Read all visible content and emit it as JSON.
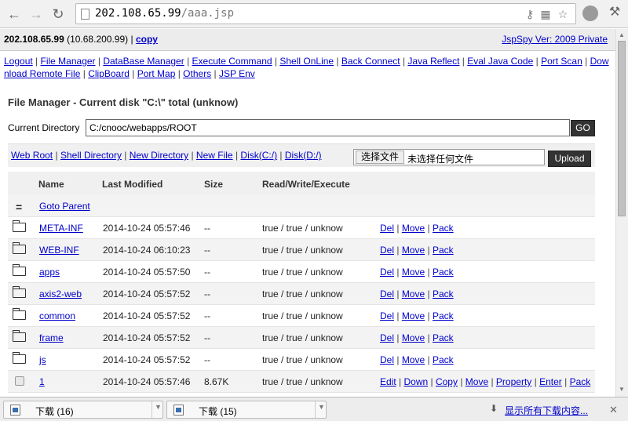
{
  "browser": {
    "url_host": "202.108.65.99",
    "url_path": "/aaa.jsp"
  },
  "header": {
    "ip_bold": "202.108.65.99",
    "ip_inner": " (10.68.200.99) | ",
    "copy_label": "copy",
    "version_label": "JspSpy Ver: 2009 Private"
  },
  "nav_links": [
    "Logout",
    "File Manager",
    "DataBase Manager",
    "Execute Command",
    "Shell OnLine",
    "Back Connect",
    "Java Reflect",
    "Eval Java Code",
    "Port Scan",
    "Download Remote File",
    "ClipBoard",
    "Port Map",
    "Others",
    "JSP Env"
  ],
  "page_title": "File Manager - Current disk \"C:\\\" total (unknow)",
  "current_dir": {
    "label": "Current Directory",
    "value": "C:/cnooc/webapps/ROOT",
    "go_label": "GO"
  },
  "quick_links": [
    "Web Root",
    "Shell Directory",
    "New Directory",
    "New File",
    "Disk(C:/)",
    "Disk(D:/)"
  ],
  "upload": {
    "choose_label": "选择文件",
    "no_file_text": "未选择任何文件",
    "upload_label": "Upload"
  },
  "table": {
    "headers": [
      "Name",
      "Last Modified",
      "Size",
      "Read/Write/Execute"
    ],
    "goto_parent": "Goto Parent",
    "rows": [
      {
        "name": "META-INF",
        "modified": "2014-10-24 05:57:46",
        "size": "--",
        "perm": "true / true / unknow",
        "type": "dir"
      },
      {
        "name": "WEB-INF",
        "modified": "2014-10-24 06:10:23",
        "size": "--",
        "perm": "true / true / unknow",
        "type": "dir"
      },
      {
        "name": "apps",
        "modified": "2014-10-24 05:57:50",
        "size": "--",
        "perm": "true / true / unknow",
        "type": "dir"
      },
      {
        "name": "axis2-web",
        "modified": "2014-10-24 05:57:52",
        "size": "--",
        "perm": "true / true / unknow",
        "type": "dir"
      },
      {
        "name": "common",
        "modified": "2014-10-24 05:57:52",
        "size": "--",
        "perm": "true / true / unknow",
        "type": "dir"
      },
      {
        "name": "frame",
        "modified": "2014-10-24 05:57:52",
        "size": "--",
        "perm": "true / true / unknow",
        "type": "dir"
      },
      {
        "name": "js",
        "modified": "2014-10-24 05:57:52",
        "size": "--",
        "perm": "true / true / unknow",
        "type": "dir"
      },
      {
        "name": "1",
        "modified": "2014-10-24 05:57:46",
        "size": "8.67K",
        "perm": "true / true / unknow",
        "type": "file"
      }
    ],
    "dir_actions": [
      "Del",
      "Move",
      "Pack"
    ],
    "file_actions": [
      "Edit",
      "Down",
      "Copy",
      "Move",
      "Property",
      "Enter",
      "Pack"
    ]
  },
  "downloads": {
    "items": [
      "下载 (16)",
      "下载 (15)"
    ],
    "show_all": "显示所有下载内容..."
  }
}
